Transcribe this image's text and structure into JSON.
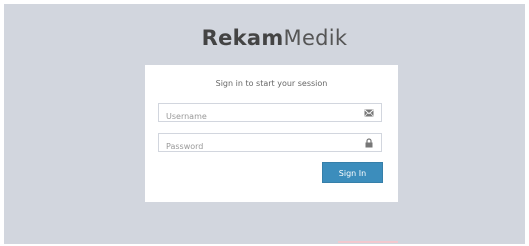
{
  "logo": {
    "bold": "Rekam",
    "light": "Medik"
  },
  "login": {
    "message": "Sign in to start your session",
    "username_placeholder": "Username",
    "password_placeholder": "Password",
    "signin_label": "Sign In"
  },
  "icons": {
    "username": "envelope-icon",
    "password": "lock-icon"
  },
  "colors": {
    "background": "#d2d6de",
    "box": "#ffffff",
    "primary_button": "#3c8dbc"
  }
}
